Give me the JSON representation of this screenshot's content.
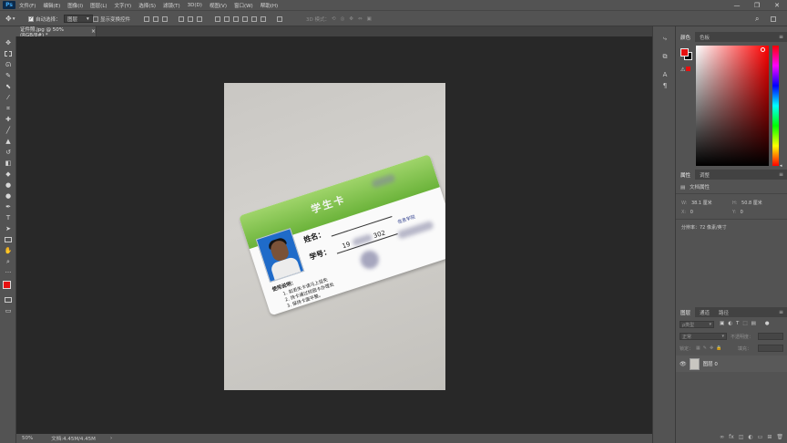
{
  "menubar": {
    "app_icon": "Ps",
    "items": [
      "文件(F)",
      "编辑(E)",
      "图像(I)",
      "图层(L)",
      "文字(Y)",
      "选择(S)",
      "滤镜(T)",
      "3D(D)",
      "视图(V)",
      "窗口(W)",
      "帮助(H)"
    ],
    "window_controls": [
      "—",
      "❐",
      "✕"
    ]
  },
  "options": {
    "auto_select_label": "自动选择：",
    "auto_select_target": "图层",
    "show_transform_label": "显示变换控件",
    "mode_3d_label": "3D 模式："
  },
  "document": {
    "tab_label": "证件照.jpg @ 50%(RGB/8#) *",
    "card_title": "学生卡",
    "name_label": "姓名：",
    "id_label": "学号：",
    "id_value_start": "19",
    "id_value_end": "302",
    "dept_partial": "信息学院",
    "instructions_title": "使用说明：",
    "instructions": [
      "1. 如丢失卡请马上挂失",
      "2. 持卡通过校园卡办理处",
      "3. 保持卡面平整。"
    ]
  },
  "status": {
    "zoom": "50%",
    "doc_info": "文档:4.45M/4.45M",
    "arrow": "›"
  },
  "color_panel": {
    "tabs": [
      "颜色",
      "色板"
    ],
    "fg_color": "#e61010",
    "bg_color": "#000000"
  },
  "properties_panel": {
    "tabs": [
      "属性",
      "调整"
    ],
    "header": "文档属性",
    "w_label": "W:",
    "w_value": "38.1 厘米",
    "h_label": "H:",
    "h_value": "50.8 厘米",
    "x_label": "X:",
    "x_value": "0",
    "y_label": "Y:",
    "y_value": "0",
    "resolution": "分辨率：72 像素/英寸"
  },
  "layers_panel": {
    "tabs": [
      "图层",
      "通道",
      "路径"
    ],
    "filter_kind": "ρ类型",
    "blend_mode": "正常",
    "opacity_label": "不透明度：",
    "lock_label": "锁定：",
    "fill_label": "填充：",
    "layer_name": "图层 0"
  }
}
